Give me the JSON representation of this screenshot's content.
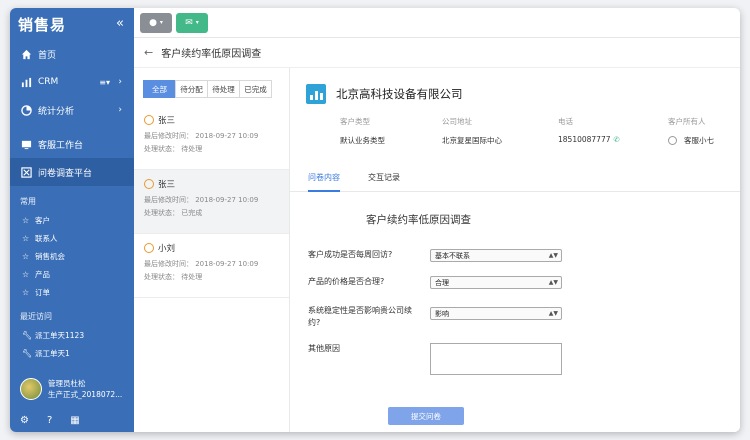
{
  "app": {
    "logo": "销售易"
  },
  "sidebar": {
    "nav": [
      {
        "label": "首页"
      },
      {
        "label": "CRM"
      },
      {
        "label": "统计分析"
      },
      {
        "label": "客服工作台"
      },
      {
        "label": "问卷调查平台"
      }
    ],
    "common_title": "常用",
    "common": [
      {
        "label": "客户"
      },
      {
        "label": "联系人"
      },
      {
        "label": "销售机会"
      },
      {
        "label": "产品"
      },
      {
        "label": "订单"
      }
    ],
    "recent_title": "最近访问",
    "recent": [
      {
        "label": "派工单天1123"
      },
      {
        "label": "派工单天1"
      }
    ],
    "user": {
      "name": "管理员杜松",
      "subtitle": "生产正式_2018072..."
    }
  },
  "page": {
    "title": "客户续约率低原因调查"
  },
  "filters": [
    "全部",
    "待分配",
    "待处理",
    "已完成"
  ],
  "list": [
    {
      "name": "张三",
      "modified": "最后修改时间： 2018-09-27  10:09",
      "status": "处理状态： 待处理"
    },
    {
      "name": "张三",
      "modified": "最后修改时间： 2018-09-27  10:09",
      "status": "处理状态： 已完成"
    },
    {
      "name": "小刘",
      "modified": "最后修改时间： 2018-09-27  10:09",
      "status": "处理状态： 待处理"
    }
  ],
  "detail": {
    "company": "北京高科技设备有限公司",
    "fields": [
      {
        "key": "客户类型",
        "value": "默认业务类型"
      },
      {
        "key": "公司地址",
        "value": "北京复星国际中心"
      },
      {
        "key": "电话",
        "value": "18510087777"
      },
      {
        "key": "客户所有人",
        "value": "客服小七"
      }
    ],
    "tabs": [
      "问卷内容",
      "交互记录"
    ],
    "form_title": "客户续约率低原因调查",
    "questions": [
      {
        "label": "客户成功是否每周回访?",
        "answer": "基本不联系"
      },
      {
        "label": "产品的价格是否合理?",
        "answer": "合理"
      },
      {
        "label": "系统稳定性是否影响贵公司续约?",
        "answer": "影响"
      },
      {
        "label": "其他原因"
      }
    ],
    "submit": "提交问卷"
  },
  "colors": {
    "sidebar": "#3a6fb8",
    "accent": "#3a7be0",
    "submit": "#7fa4ea"
  }
}
